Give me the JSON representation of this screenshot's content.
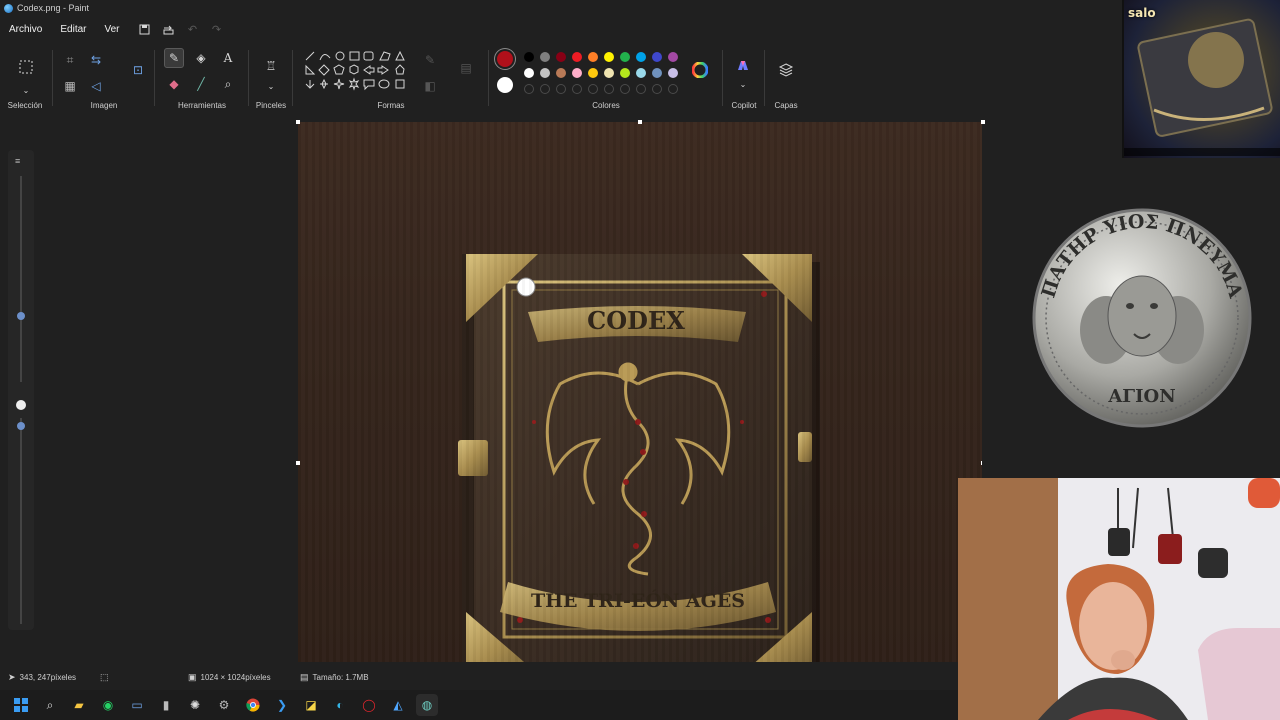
{
  "window": {
    "title": "Codex.png - Paint"
  },
  "menu": {
    "items": [
      "Archivo",
      "Editar",
      "Ver"
    ]
  },
  "ribbon": {
    "groups": {
      "seleccion": "Selección",
      "imagen": "Imagen",
      "herramientas": "Herramientas",
      "pinceles": "Pinceles",
      "formas": "Formas",
      "colores": "Colores",
      "copilot": "Copilot",
      "capas": "Capas"
    },
    "primary_color": "#b0101a",
    "secondary_color": "#ffffff",
    "palette_row1": [
      "#000000",
      "#7f7f7f",
      "#880015",
      "#ed1c24",
      "#ff7f27",
      "#fff200",
      "#22b14c",
      "#00a2e8",
      "#3f48cc",
      "#a349a4"
    ],
    "palette_row2": [
      "#ffffff",
      "#c3c3c3",
      "#b97a57",
      "#ffaec9",
      "#ffc90e",
      "#efe4b0",
      "#b5e61d",
      "#99d9ea",
      "#7092be",
      "#c8bfe7"
    ]
  },
  "canvas": {
    "book_title": "CODEX",
    "book_subtitle": "THE TRI-EÓN AGES"
  },
  "coin": {
    "inscription": "ΠΑΤΗΡ ΥΙΟΣ ΠΝΕΥΜΑ",
    "bottom": "ΑΓΙΟΝ"
  },
  "overlay": {
    "brand": "salo"
  },
  "status": {
    "cursor": "343, 247píxeles",
    "dimensions": "1024 × 1024píxeles",
    "size": "Tamaño: 1.7MB"
  },
  "taskbar": {
    "icons": [
      "windows-start-icon",
      "search-icon",
      "file-explorer-icon",
      "whatsapp-icon",
      "app-icon",
      "usb-icon",
      "chatgpt-icon",
      "settings-icon",
      "chrome-icon",
      "vscode-icon",
      "sticky-notes-icon",
      "edge-icon",
      "opera-icon",
      "paint-icon",
      "globe-icon"
    ]
  }
}
